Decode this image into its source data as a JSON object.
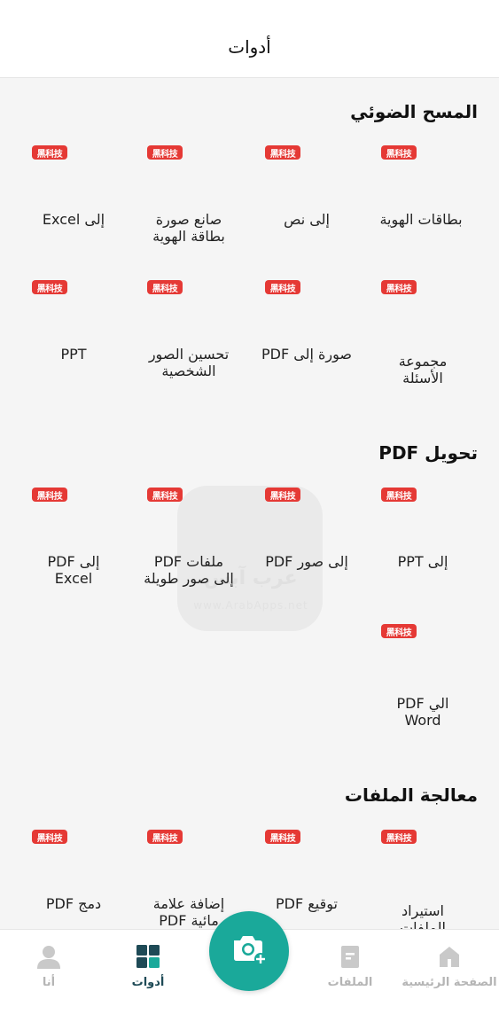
{
  "header": {
    "title": "أدوات"
  },
  "badge_text": "黑科技",
  "sections": [
    {
      "title": "المسح الضوئي",
      "tools": [
        {
          "label": "بطاقات الهوية"
        },
        {
          "label": "إلى نص"
        },
        {
          "label": "صانع صورة\nبطاقة الهوية"
        },
        {
          "label": "إلى Excel"
        },
        {
          "label": "مجموعة\nالأسئلة"
        },
        {
          "label": "صورة إلى PDF"
        },
        {
          "label": "تحسين الصور\nالشخصية"
        },
        {
          "label": "PPT"
        }
      ]
    },
    {
      "title": "تحويل PDF",
      "tools": [
        {
          "label": "إلى PPT"
        },
        {
          "label": "إلى صور PDF"
        },
        {
          "label": "ملفات PDF\nإلى صور طويلة"
        },
        {
          "label": "إلى PDF\nExcel"
        },
        {
          "label": "الي PDF\nWord"
        }
      ]
    },
    {
      "title": "معالجة الملفات",
      "tools": [
        {
          "label": "استيراد\nالملفات"
        },
        {
          "label": "توقيع PDF"
        },
        {
          "label": "إضافة علامة\nمائية PDF"
        },
        {
          "label": "دمج PDF"
        }
      ]
    }
  ],
  "watermark": {
    "text": "عرب آبس",
    "url": "www.ArabApps.net"
  },
  "bottom_nav": {
    "home": "الصفحة الرئيسية",
    "files": "الملفات",
    "tools": "أدوات",
    "me": "أنا"
  },
  "colors": {
    "accent": "#1aa99a",
    "badge": "#e53935",
    "active_nav": "#1e4a56",
    "inactive_nav": "#b5b5b5"
  }
}
